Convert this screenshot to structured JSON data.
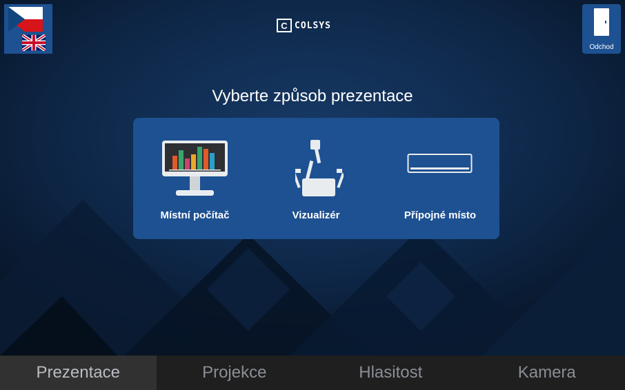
{
  "header": {
    "logo_text": "COLSYS",
    "logo_letter": "C",
    "language_icons": [
      "flag-cz-icon",
      "flag-uk-icon"
    ],
    "exit_label": "Odchod"
  },
  "main": {
    "prompt": "Vyberte způsob prezentace",
    "sources": [
      {
        "label": "Místní počítač",
        "icon": "computer-monitor-icon"
      },
      {
        "label": "Vizualizér",
        "icon": "document-camera-icon"
      },
      {
        "label": "Přípojné místo",
        "icon": "connection-box-icon"
      }
    ]
  },
  "tabs": [
    {
      "label": "Prezentace",
      "active": true
    },
    {
      "label": "Projekce",
      "active": false
    },
    {
      "label": "Hlasitost",
      "active": false
    },
    {
      "label": "Kamera",
      "active": false
    }
  ],
  "colors": {
    "panel": "#1d5191",
    "background": "#0d2442",
    "tabbar": "#1f1f1f",
    "tab_active": "#313131"
  }
}
